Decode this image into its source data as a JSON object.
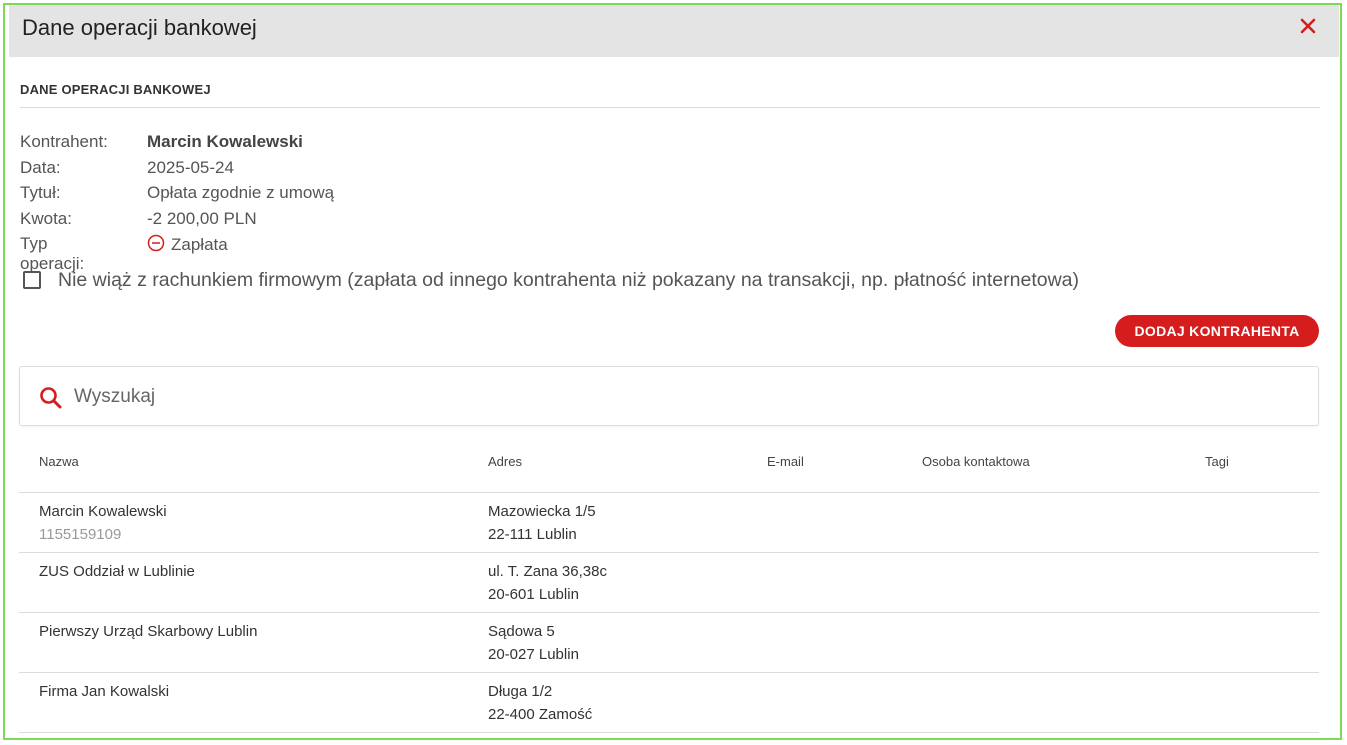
{
  "dialog": {
    "title": "Dane operacji bankowej",
    "close_icon": "close-icon",
    "close_color": "#d61d1d"
  },
  "section": {
    "title": "DANE OPERACJI BANKOWEJ"
  },
  "info": {
    "kontrahent_label": "Kontrahent:",
    "kontrahent_value": "Marcin Kowalewski",
    "data_label": "Data:",
    "data_value": "2025-05-24",
    "tytul_label": "Tytuł:",
    "tytul_value": "Opłata zgodnie z umową",
    "kwota_label": "Kwota:",
    "kwota_value": "-2 200,00 PLN",
    "typ_label": "Typ operacji:",
    "typ_value": "Zapłata",
    "typ_icon": "minus-circle-icon"
  },
  "checkbox": {
    "label": "Nie wiąż z rachunkiem firmowym (zapłata od innego kontrahenta niż pokazany na transakcji, np. płatność internetowa)",
    "checked": false
  },
  "add_button": {
    "label": "DODAJ KONTRAHENTA",
    "color": "#d61d1d"
  },
  "search": {
    "placeholder": "Wyszukaj",
    "value": "",
    "icon": "search-icon"
  },
  "table": {
    "columns": [
      "Nazwa",
      "Adres",
      "E-mail",
      "Osoba kontaktowa",
      "Tagi"
    ],
    "rows": [
      {
        "name": "Marcin Kowalewski",
        "sub": "1155159109",
        "addr1": "Mazowiecka 1/5",
        "addr2": "22-111 Lublin",
        "email": "",
        "contact": "",
        "tags": ""
      },
      {
        "name": "ZUS Oddział w Lublinie",
        "sub": "",
        "addr1": "ul. T. Zana 36,38c",
        "addr2": "20-601 Lublin",
        "email": "",
        "contact": "",
        "tags": ""
      },
      {
        "name": "Pierwszy Urząd Skarbowy Lublin",
        "sub": "",
        "addr1": "Sądowa 5",
        "addr2": "20-027 Lublin",
        "email": "",
        "contact": "",
        "tags": ""
      },
      {
        "name": "Firma Jan Kowalski",
        "sub": "",
        "addr1": "Długa 1/2",
        "addr2": "22-400 Zamość",
        "email": "",
        "contact": "",
        "tags": ""
      }
    ]
  },
  "colors": {
    "accent": "#d61d1d",
    "frame_border": "#7ed957",
    "header_bg": "#e4e4e4"
  }
}
